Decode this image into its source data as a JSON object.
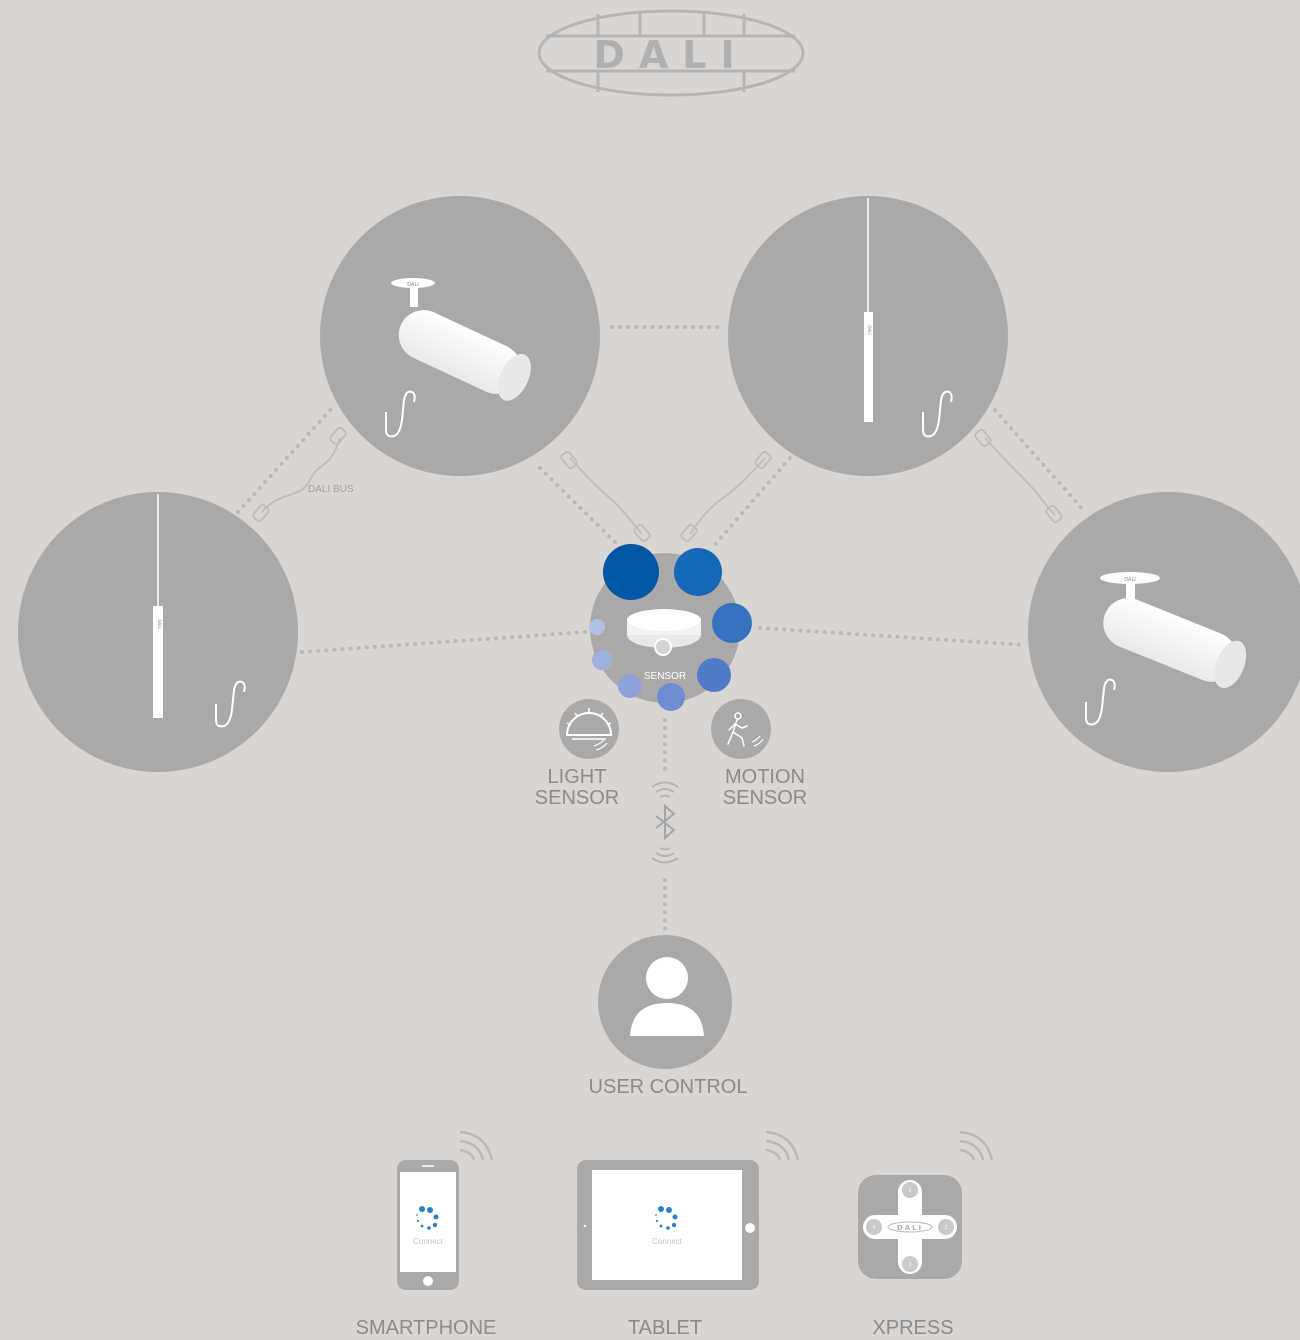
{
  "logo": {
    "text": "DALI"
  },
  "labels": {
    "dali_bus": "DALI BUS",
    "sensor": "SENSOR",
    "light_sensor_line1": "LIGHT",
    "light_sensor_line2": "SENSOR",
    "motion_sensor_line1": "MOTION",
    "motion_sensor_line2": "SENSOR",
    "user_control": "USER CONTROL",
    "smartphone": "SMARTPHONE",
    "tablet": "TABLET",
    "xpress": "XPRESS"
  },
  "devices": {
    "connect_text": "Connect",
    "xpress_buttons": [
      "1",
      "2",
      "3",
      "4"
    ],
    "fixture_badge": "DALI"
  },
  "colors": {
    "background": "#d8d5d3",
    "node_circle": "#aaa9a8",
    "sensor_blue_dark": "#0057a6",
    "sensor_blue_mid": "#1468b7",
    "sensor_blue_light": "#a9b8e2",
    "text": "#8c8c8c",
    "white": "#ffffff"
  }
}
